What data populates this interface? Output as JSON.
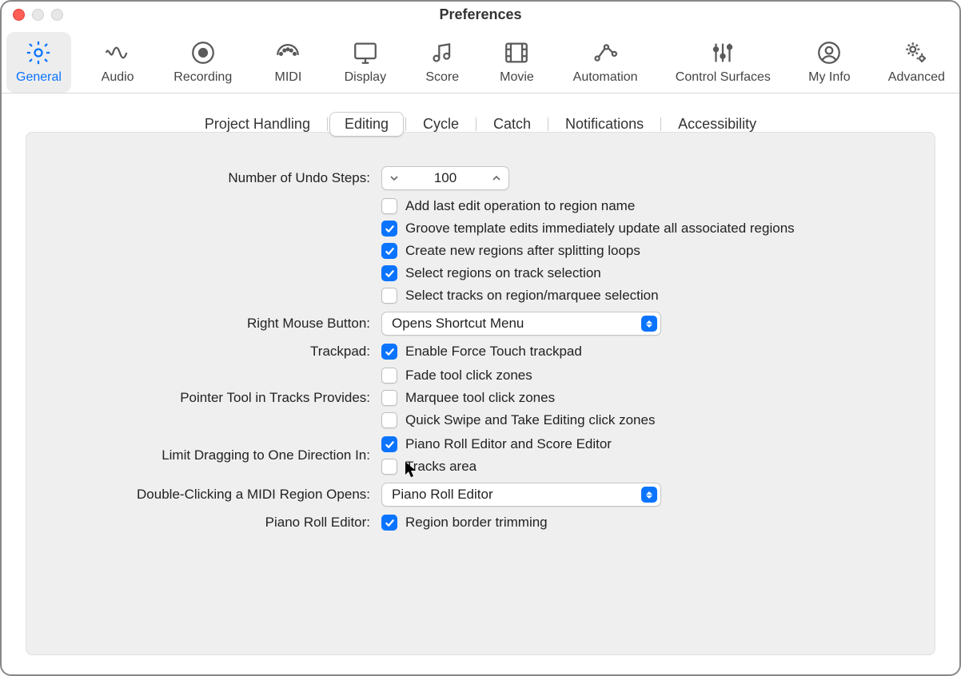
{
  "window": {
    "title": "Preferences"
  },
  "toolbar": [
    {
      "name": "general",
      "label": "General",
      "selected": true
    },
    {
      "name": "audio",
      "label": "Audio",
      "selected": false
    },
    {
      "name": "recording",
      "label": "Recording",
      "selected": false
    },
    {
      "name": "midi",
      "label": "MIDI",
      "selected": false
    },
    {
      "name": "display",
      "label": "Display",
      "selected": false
    },
    {
      "name": "score",
      "label": "Score",
      "selected": false
    },
    {
      "name": "movie",
      "label": "Movie",
      "selected": false
    },
    {
      "name": "automation",
      "label": "Automation",
      "selected": false
    },
    {
      "name": "control-surfaces",
      "label": "Control Surfaces",
      "selected": false
    },
    {
      "name": "my-info",
      "label": "My Info",
      "selected": false
    },
    {
      "name": "advanced",
      "label": "Advanced",
      "selected": false
    }
  ],
  "subtabs": [
    {
      "name": "project-handling",
      "label": "Project Handling",
      "selected": false
    },
    {
      "name": "editing",
      "label": "Editing",
      "selected": true
    },
    {
      "name": "cycle",
      "label": "Cycle",
      "selected": false
    },
    {
      "name": "catch",
      "label": "Catch",
      "selected": false
    },
    {
      "name": "notifications",
      "label": "Notifications",
      "selected": false
    },
    {
      "name": "accessibility",
      "label": "Accessibility",
      "selected": false
    }
  ],
  "labels": {
    "undo_steps": "Number of Undo Steps:",
    "right_mouse": "Right Mouse Button:",
    "trackpad": "Trackpad:",
    "pointer_tool": "Pointer Tool in Tracks Provides:",
    "limit_drag": "Limit Dragging to One Direction In:",
    "double_click_midi": "Double-Clicking a MIDI Region Opens:",
    "piano_roll_editor": "Piano Roll Editor:"
  },
  "values": {
    "undo_steps": "100",
    "right_mouse_select": "Opens Shortcut Menu",
    "double_click_midi_select": "Piano Roll Editor"
  },
  "checkboxes": {
    "add_last_edit": {
      "label": "Add last edit operation to region name",
      "checked": false
    },
    "groove_template": {
      "label": "Groove template edits immediately update all associated regions",
      "checked": true
    },
    "create_regions": {
      "label": "Create new regions after splitting loops",
      "checked": true
    },
    "select_regions": {
      "label": "Select regions on track selection",
      "checked": true
    },
    "select_tracks": {
      "label": "Select tracks on region/marquee selection",
      "checked": false
    },
    "force_touch": {
      "label": "Enable Force Touch trackpad",
      "checked": true
    },
    "fade_tool": {
      "label": "Fade tool click zones",
      "checked": false
    },
    "marquee_tool": {
      "label": "Marquee tool click zones",
      "checked": false
    },
    "quick_swipe": {
      "label": "Quick Swipe and Take Editing click zones",
      "checked": false
    },
    "piano_score": {
      "label": "Piano Roll Editor and Score Editor",
      "checked": true
    },
    "tracks_area": {
      "label": "Tracks area",
      "checked": false
    },
    "region_border_trim": {
      "label": "Region border trimming",
      "checked": true
    }
  }
}
